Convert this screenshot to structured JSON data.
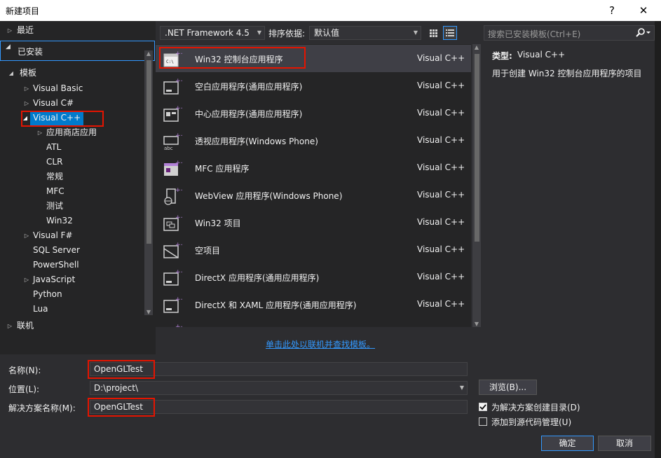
{
  "window": {
    "title": "新建项目",
    "help_symbol": "?",
    "close_symbol": "✕"
  },
  "tree": {
    "recent": "最近",
    "installed": "已安装",
    "templates": "模板",
    "items": [
      {
        "label": "Visual Basic"
      },
      {
        "label": "Visual C#"
      },
      {
        "label": "Visual C++"
      },
      {
        "label": "应用商店应用"
      },
      {
        "label": "ATL"
      },
      {
        "label": "CLR"
      },
      {
        "label": "常规"
      },
      {
        "label": "MFC"
      },
      {
        "label": "测试"
      },
      {
        "label": "Win32"
      },
      {
        "label": "Visual F#"
      },
      {
        "label": "SQL Server"
      },
      {
        "label": "PowerShell"
      },
      {
        "label": "JavaScript"
      },
      {
        "label": "Python"
      },
      {
        "label": "Lua"
      }
    ],
    "online": "联机"
  },
  "toolbar": {
    "framework": ".NET Framework 4.5",
    "sort_label": "排序依据:",
    "sort_value": "默认值"
  },
  "search": {
    "placeholder": "搜索已安装模板(Ctrl+E)"
  },
  "templates": [
    {
      "name": "Win32 控制台应用程序",
      "lang": "Visual C++",
      "icon": "console-app-icon"
    },
    {
      "name": "空白应用程序(通用应用程序)",
      "lang": "Visual C++",
      "icon": "blank-app-icon"
    },
    {
      "name": "中心应用程序(通用应用程序)",
      "lang": "Visual C++",
      "icon": "hub-app-icon"
    },
    {
      "name": "透视应用程序(Windows Phone)",
      "lang": "Visual C++",
      "icon": "pivot-app-icon"
    },
    {
      "name": "MFC 应用程序",
      "lang": "Visual C++",
      "icon": "mfc-app-icon"
    },
    {
      "name": "WebView 应用程序(Windows Phone)",
      "lang": "Visual C++",
      "icon": "webview-app-icon"
    },
    {
      "name": "Win32 项目",
      "lang": "Visual C++",
      "icon": "win32-project-icon"
    },
    {
      "name": "空项目",
      "lang": "Visual C++",
      "icon": "empty-project-icon"
    },
    {
      "name": "DirectX 应用程序(通用应用程序)",
      "lang": "Visual C++",
      "icon": "directx-app-icon"
    },
    {
      "name": "DirectX 和 XAML 应用程序(通用应用程序)",
      "lang": "Visual C++",
      "icon": "directx-xaml-app-icon"
    }
  ],
  "details": {
    "type_label": "类型:",
    "type_value": "Visual C++",
    "description": "用于创建 Win32 控制台应用程序的项目"
  },
  "online_link": "单击此处以联机并查找模板。",
  "form": {
    "name_label": "名称(N):",
    "name_value": "OpenGLTest",
    "location_label": "位置(L):",
    "location_value": "D:\\project\\",
    "solution_label": "解决方案名称(M):",
    "solution_value": "OpenGLTest",
    "browse": "浏览(B)...",
    "create_dir": "为解决方案创建目录(D)",
    "create_dir_checked": true,
    "source_control": "添加到源代码管理(U)",
    "source_control_checked": false,
    "ok": "确定",
    "cancel": "取消"
  },
  "colors": {
    "accent": "#007acc",
    "highlight_box": "#e51400",
    "link": "#3399ff"
  }
}
